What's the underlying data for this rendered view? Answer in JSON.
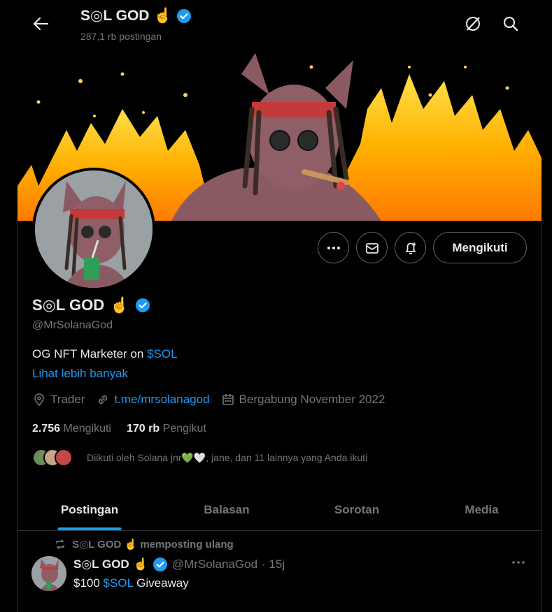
{
  "header": {
    "name": "S◎L GOD",
    "emoji": "☝️",
    "posts_count": "287,1 rb postingan"
  },
  "profile": {
    "name": "S◎L GOD",
    "emoji": "☝️",
    "handle": "@MrSolanaGod",
    "bio_text": "OG NFT Marketer on ",
    "bio_link": "$SOL",
    "see_more": "Lihat lebih banyak",
    "location": "Trader",
    "website": "t.me/mrsolanagod",
    "joined": "Bergabung November 2022",
    "following_count": "2.756",
    "following_label": "Mengikuti",
    "followers_count": "170 rb",
    "followers_label": "Pengikut",
    "followed_by": "Diikuti oleh Solana jnr💚🤍, jane, dan 11 lainnya yang Anda ikuti",
    "follow_button": "Mengikuti"
  },
  "tabs": [
    {
      "label": "Postingan",
      "active": true
    },
    {
      "label": "Balasan",
      "active": false
    },
    {
      "label": "Sorotan",
      "active": false
    },
    {
      "label": "Media",
      "active": false
    }
  ],
  "post": {
    "repost_label": "S◎L GOD ☝️ memposting ulang",
    "author_name": "S◎L GOD",
    "author_emoji": "☝️",
    "author_handle": "@MrSolanaGod",
    "time": "· 15j",
    "text_prefix": "$100 ",
    "text_link": "$SOL",
    "text_suffix": " Giveaway"
  },
  "colors": {
    "accent": "#1d9bf0",
    "muted": "#71767b",
    "border": "#2f3336"
  }
}
